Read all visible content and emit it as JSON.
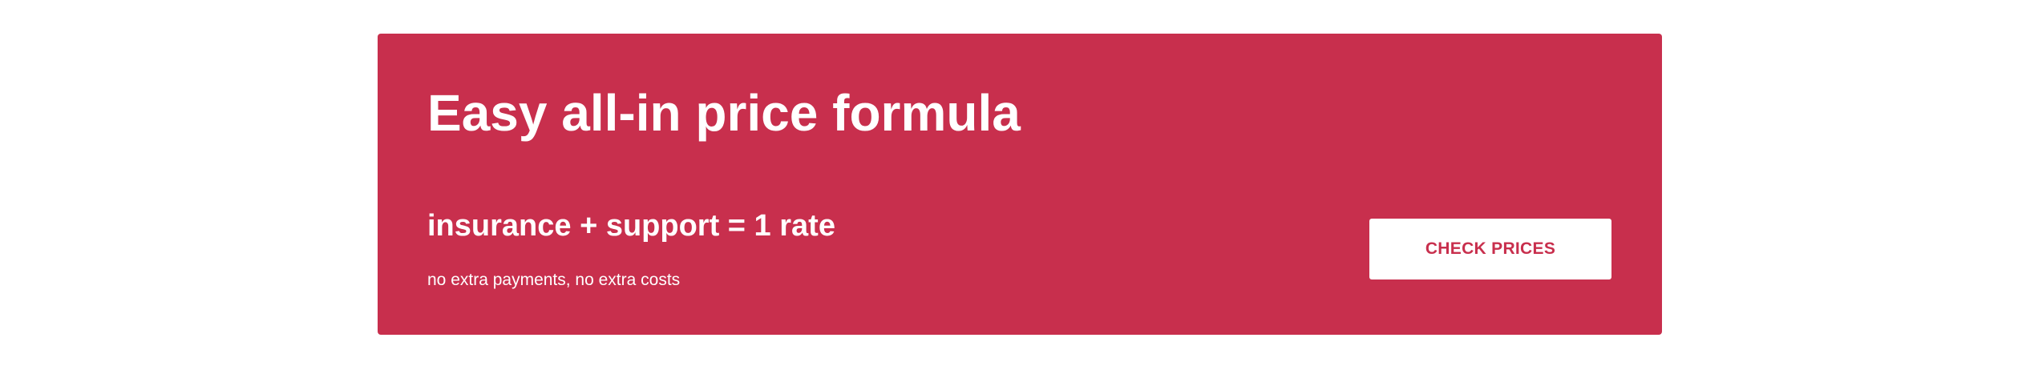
{
  "promo": {
    "title": "Easy all-in price formula",
    "formula": "insurance + support = 1 rate",
    "note": "no extra payments, no extra costs",
    "cta_label": "CHECK PRICES"
  },
  "colors": {
    "card_background": "#c82f4d",
    "card_text": "#ffffff",
    "button_background": "#ffffff",
    "button_text": "#c82f4d"
  }
}
